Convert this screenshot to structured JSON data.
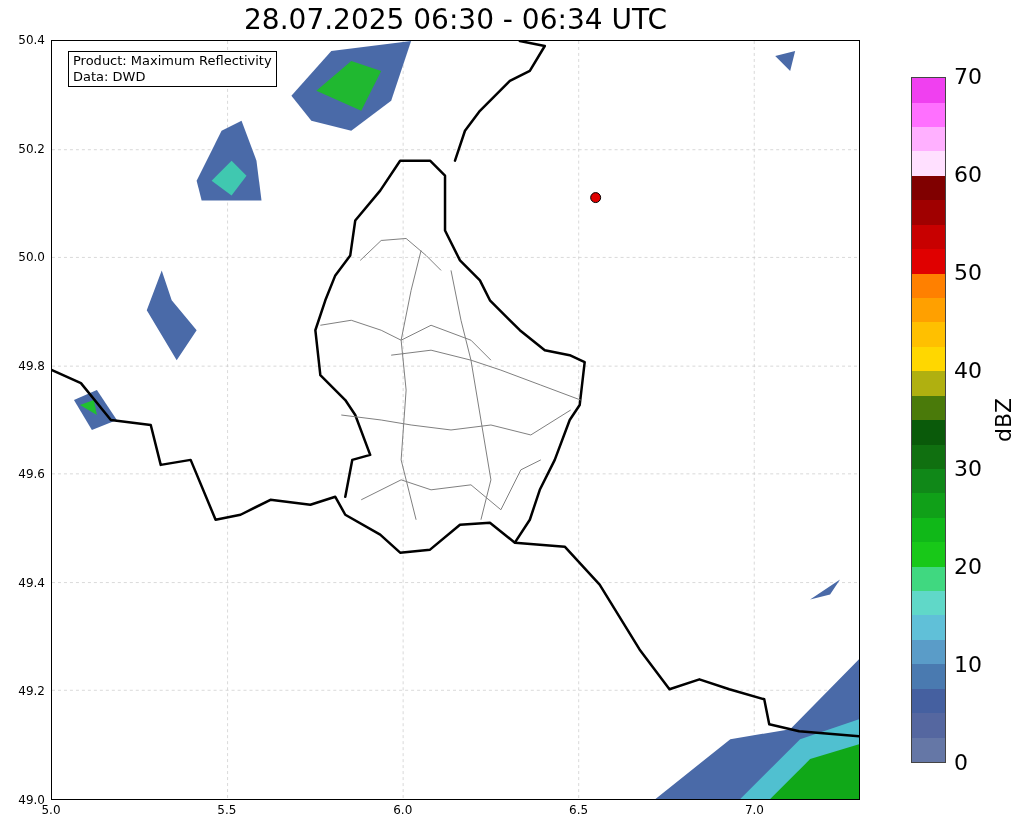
{
  "title": "28.07.2025 06:30 - 06:34 UTC",
  "legend": [
    "Product: Maximum Reflectivity",
    "Data: DWD"
  ],
  "yticks": [
    "50.4",
    "50.2",
    "50.0",
    "49.8",
    "49.6",
    "49.4",
    "49.2",
    "49.0"
  ],
  "xticks": [
    "5.0",
    "5.5",
    "6.0",
    "6.5",
    "7.0"
  ],
  "colorbar": {
    "label": "dBZ",
    "ticks": [
      "70",
      "60",
      "50",
      "40",
      "30",
      "20",
      "10",
      "0"
    ],
    "bins": [
      {
        "color": "#6577a6"
      },
      {
        "color": "#5567a0"
      },
      {
        "color": "#4560a0"
      },
      {
        "color": "#4a7ab0"
      },
      {
        "color": "#5a9cc8"
      },
      {
        "color": "#60c0d8"
      },
      {
        "color": "#60d8c8"
      },
      {
        "color": "#40d880"
      },
      {
        "color": "#18c818"
      },
      {
        "color": "#10b818"
      },
      {
        "color": "#10a018"
      },
      {
        "color": "#108818"
      },
      {
        "color": "#107010"
      },
      {
        "color": "#0a5a0a"
      },
      {
        "color": "#4a7a0a"
      },
      {
        "color": "#b0b010"
      },
      {
        "color": "#ffd700"
      },
      {
        "color": "#ffc000"
      },
      {
        "color": "#ffa000"
      },
      {
        "color": "#ff8000"
      },
      {
        "color": "#e00000"
      },
      {
        "color": "#c80000"
      },
      {
        "color": "#a00000"
      },
      {
        "color": "#800000"
      },
      {
        "color": "#ffe0ff"
      },
      {
        "color": "#ffb0ff"
      },
      {
        "color": "#ff70ff"
      },
      {
        "color": "#f040f0"
      }
    ]
  }
}
